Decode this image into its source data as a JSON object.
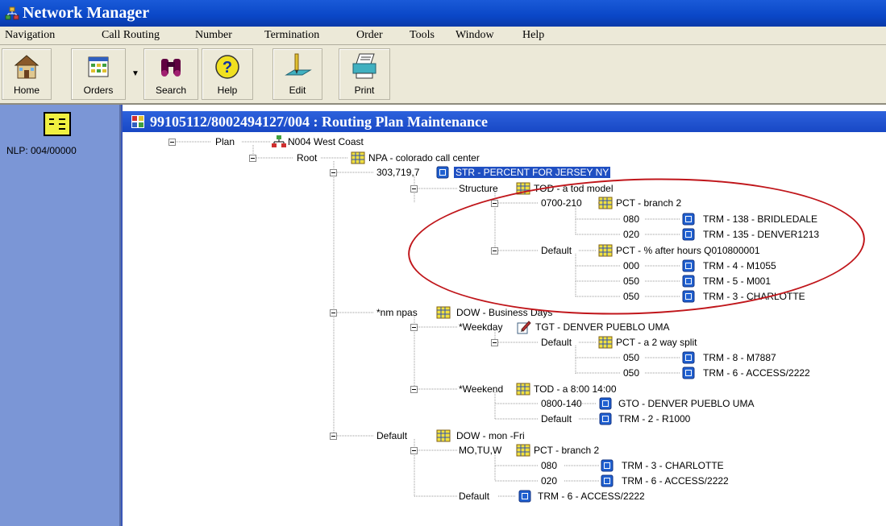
{
  "window": {
    "title": "Network Manager",
    "app_icon": "network-icon"
  },
  "menu": [
    "Navigation",
    "Call Routing",
    "Number",
    "Termination",
    "Order",
    "Tools",
    "Window",
    "Help"
  ],
  "toolbar": {
    "home": "Home",
    "orders": "Orders",
    "search": "Search",
    "help": "Help",
    "edit": "Edit",
    "print": "Print"
  },
  "sidebar": {
    "label": "NLP: 004/00000"
  },
  "child_window": {
    "title": "99105112/8002494127/004 : Routing Plan Maintenance"
  },
  "tree": {
    "plan_label": "Plan",
    "plan_value": "N004  West Coast",
    "root_label": "Root",
    "root_value": "NPA - colorado call center",
    "n1_label": "303,719,7",
    "n1_value": "STR - PERCENT FOR JERSEY NY",
    "n2_label": "Structure",
    "n2_value": "TOD - a tod model",
    "n3_label": "0700-210",
    "n3_value": "PCT - branch 2",
    "n4_label": "080",
    "n4_value": "TRM - 138 - BRIDLEDALE",
    "n5_label": "020",
    "n5_value": "TRM - 135 - DENVER1213",
    "n6_label": "Default",
    "n6_value": "PCT - % after hours  Q010800001",
    "n7_label": "000",
    "n7_value": "TRM - 4 - M1055",
    "n8_label": "050",
    "n8_value": "TRM - 5 - M001",
    "n9_label": "050",
    "n9_value": "TRM - 3 - CHARLOTTE",
    "n10_label": "*nm npas",
    "n10_value": "DOW - Business Days",
    "n11_label": "*Weekday",
    "n11_value": "TGT - DENVER PUEBLO UMA",
    "n12_label": "Default",
    "n12_value": "PCT - a 2 way split",
    "n13_label": "050",
    "n13_value": "TRM - 8 - M7887",
    "n14_label": "050",
    "n14_value": "TRM - 6 - ACCESS/2222",
    "n15_label": "*Weekend",
    "n15_value": "TOD - a 8:00 14:00",
    "n16_label": "0800-140",
    "n16_value": "GTO - DENVER PUEBLO UMA",
    "n17_label": "Default",
    "n17_value": "TRM - 2 - R1000",
    "n18_label": "Default",
    "n18_value": "DOW - mon -Fri",
    "n19_label": "MO,TU,W",
    "n19_value": "PCT - branch 2",
    "n20_label": "080",
    "n20_value": "TRM - 3 - CHARLOTTE",
    "n21_label": "020",
    "n21_value": "TRM - 6 - ACCESS/2222",
    "n22_label": "Default",
    "n22_value": "TRM - 6 - ACCESS/2222"
  },
  "colors": {
    "title_blue": "#0a47c7",
    "sidebar": "#7b96d6",
    "annotation": "#c0161b",
    "selection": "#1f4fc2"
  }
}
